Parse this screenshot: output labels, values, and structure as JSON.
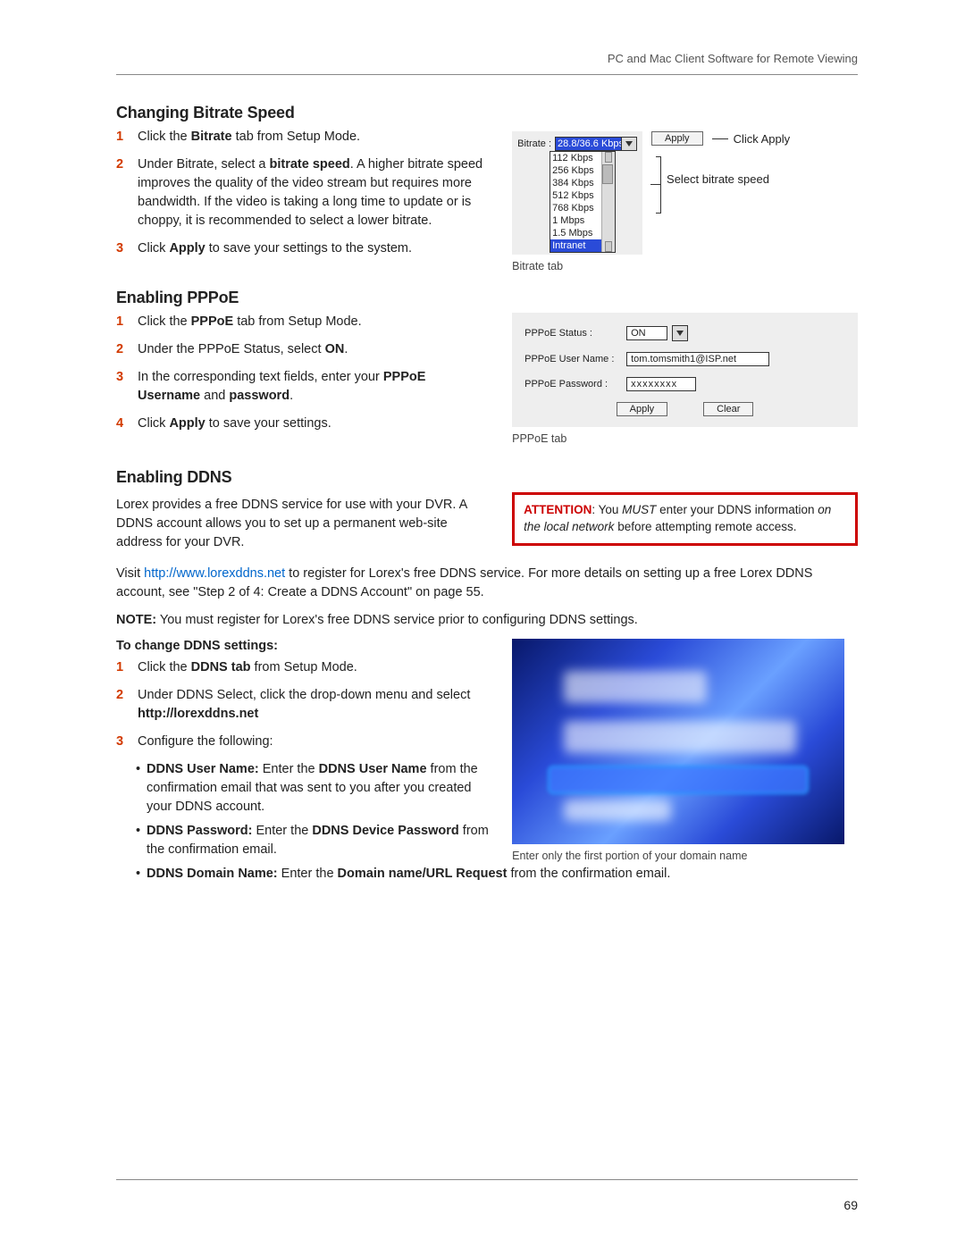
{
  "header": {
    "title": "PC and Mac Client Software for Remote Viewing"
  },
  "pageNumber": "69",
  "bitrate": {
    "heading": "Changing Bitrate Speed",
    "steps": {
      "s1a": "Click the ",
      "s1b": "Bitrate",
      "s1c": " tab from Setup Mode.",
      "s2a": "Under Bitrate, select a ",
      "s2b": "bitrate speed",
      "s2c": ". A higher bitrate speed improves the quality of the video stream but requires more bandwidth. If the video is taking a long time to update or is choppy, it is recommended to select a lower bitrate.",
      "s3a": "Click ",
      "s3b": "Apply",
      "s3c": " to save your settings to the system."
    },
    "widget": {
      "label": "Bitrate :",
      "selected": "28.8/36.6 Kbps",
      "options": [
        "112 Kbps",
        "256 Kbps",
        "384 Kbps",
        "512 Kbps",
        "768 Kbps",
        "1 Mbps",
        "1.5 Mbps",
        "Intranet"
      ],
      "apply": "Apply",
      "callout_apply": "Click Apply",
      "callout_select": "Select bitrate speed",
      "caption": "Bitrate tab"
    }
  },
  "pppoe": {
    "heading": "Enabling PPPoE",
    "steps": {
      "s1a": "Click the ",
      "s1b": "PPPoE",
      "s1c": " tab from Setup Mode.",
      "s2a": "Under the PPPoE Status, select ",
      "s2b": "ON",
      "s2c": ".",
      "s3a": "In the corresponding text fields, enter your ",
      "s3b": "PPPoE Username",
      "s3c": " and ",
      "s3d": "password",
      "s3e": ".",
      "s4a": "Click ",
      "s4b": "Apply",
      "s4c": " to save your settings."
    },
    "widget": {
      "status_label": "PPPoE Status :",
      "status_value": "ON",
      "user_label": "PPPoE User Name :",
      "user_value": "tom.tomsmith1@ISP.net",
      "pass_label": "PPPoE Password :",
      "pass_value": "xxxxxxxx",
      "apply": "Apply",
      "clear": "Clear",
      "caption": "PPPoE tab"
    }
  },
  "ddns": {
    "heading": "Enabling DDNS",
    "intro": "Lorex provides a free DDNS service for use with your DVR. A DDNS account allows you to set up a permanent web-site address for your DVR.",
    "attention": {
      "prefix": "ATTENTION",
      "t1": ": You ",
      "must": "MUST",
      "t2": " enter your DDNS information ",
      "italic": "on the local network",
      "t3": " before attempting remote access."
    },
    "visit_a": "Visit ",
    "visit_link": "http://www.lorexddns.net",
    "visit_b": " to register for Lorex's free DDNS service. For more details on setting up a free Lorex DDNS account, see \"Step 2 of 4: Create a DDNS Account\" on page 55.",
    "note_label": "NOTE:",
    "note_text": " You must register for Lorex's free DDNS service prior to configuring DDNS settings.",
    "change_heading": "To change DDNS settings:",
    "steps": {
      "s1a": "Click the ",
      "s1b": "DDNS tab",
      "s1c": " from Setup Mode.",
      "s2a": "Under DDNS Select, click the drop-down menu and select ",
      "s2b": "http://lorexddns.net",
      "s3": "Configure the following:"
    },
    "bullets": {
      "b1a": "DDNS User Name:",
      "b1b": " Enter the ",
      "b1c": "DDNS User Name",
      "b1d": " from the confirmation email that was sent to you after you created your DDNS account.",
      "b2a": "DDNS Password:",
      "b2b": " Enter the ",
      "b2c": "DDNS Device Password",
      "b2d": " from the confirmation email.",
      "b3a": "DDNS Domain Name:",
      "b3b": " Enter the ",
      "b3c": "Domain name/URL Request",
      "b3d": " from the confirmation email."
    },
    "img_caption": "Enter only the first portion of your domain name"
  }
}
